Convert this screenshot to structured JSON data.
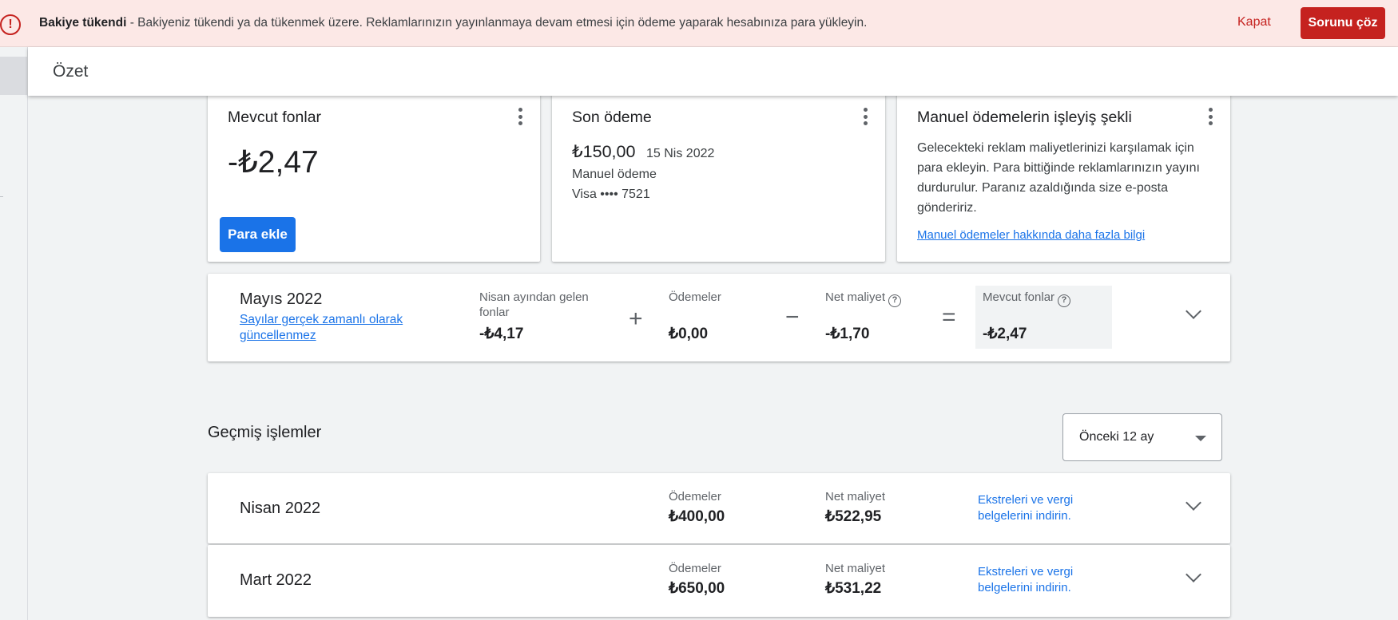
{
  "alert": {
    "icon": "error-icon",
    "title": "Bakiye tükendi",
    "message": "- Bakiyeniz tükendi ya da tükenmek üzere. Reklamlarınızın yayınlanmaya devam etmesi için ödeme yaparak hesabınıza para yükleyin.",
    "close_label": "Kapat",
    "fix_label": "Sorunu çöz",
    "accent": "#c5221f"
  },
  "header": {
    "title": "Özet"
  },
  "funds_card": {
    "title": "Mevcut fonlar",
    "amount": "-₺2,47",
    "button_label": "Para ekle"
  },
  "last_payment_card": {
    "title": "Son ödeme",
    "amount": "₺150,00",
    "date": "15 Nis 2022",
    "method": "Manuel ödeme",
    "card": "Visa •••• 7521"
  },
  "manual_info_card": {
    "title": "Manuel ödemelerin işleyiş şekli",
    "text": "Gelecekteki reklam maliyetlerinizi karşılamak için para ekleyin. Para bittiğinde reklamlarınızın yayını durdurulur. Paranız azaldığında size e-posta göndeririz.",
    "link": "Manuel ödemeler hakkında daha fazla bilgi"
  },
  "current_month": {
    "title": "Mayıs 2022",
    "note_link": "Sayılar gerçek zamanlı olarak güncellenmez",
    "carried_label": "Nisan ayından gelen fonlar",
    "carried_value": "-₺4,17",
    "plus": "+",
    "payments_label": "Ödemeler",
    "payments_value": "₺0,00",
    "minus": "−",
    "net_cost_label": "Net maliyet",
    "net_cost_value": "-₺1,70",
    "equals": "=",
    "funds_label": "Mevcut fonlar",
    "funds_value": "-₺2,47",
    "help_glyph": "?"
  },
  "history": {
    "title": "Geçmiş işlemler",
    "period_select": "Önceki 12 ay",
    "rows": [
      {
        "month": "Nisan 2022",
        "payments_label": "Ödemeler",
        "payments_value": "₺400,00",
        "net_cost_label": "Net maliyet",
        "net_cost_value": "₺522,95",
        "link": "Ekstreleri ve vergi belgelerini indirin."
      },
      {
        "month": "Mart 2022",
        "payments_label": "Ödemeler",
        "payments_value": "₺650,00",
        "net_cost_label": "Net maliyet",
        "net_cost_value": "₺531,22",
        "link": "Ekstreleri ve vergi belgelerini indirin."
      }
    ]
  },
  "colors": {
    "primary": "#1a73e8",
    "error": "#c5221f",
    "background": "#f1f3f4"
  }
}
